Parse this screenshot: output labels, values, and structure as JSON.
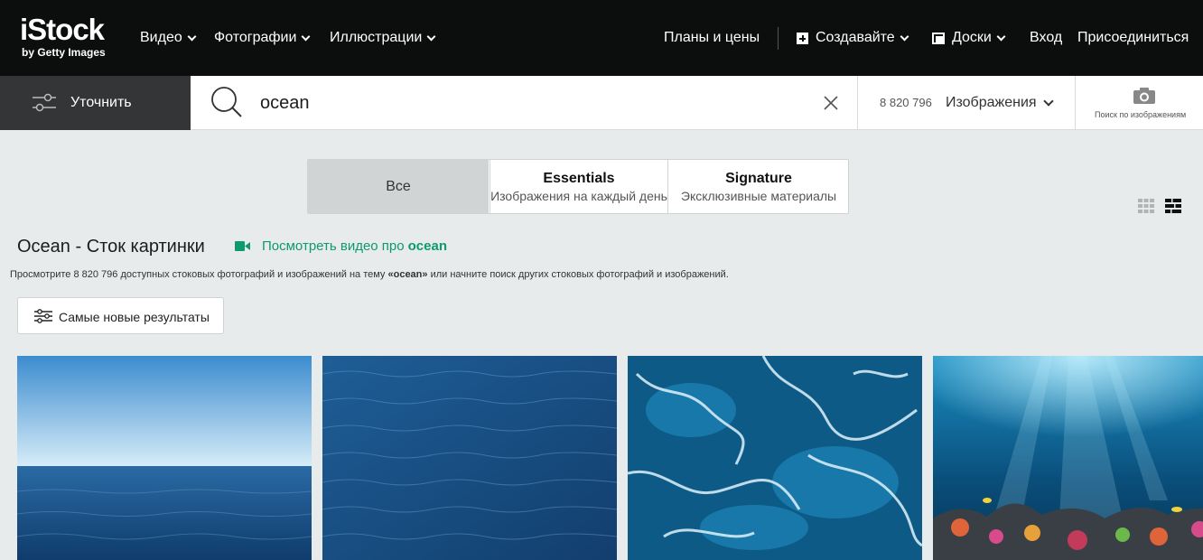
{
  "header": {
    "logo_main": "iStock",
    "logo_sub": "by Getty Images",
    "nav": [
      {
        "label": "Видео"
      },
      {
        "label": "Фотографии"
      },
      {
        "label": "Иллюстрации"
      }
    ],
    "plans_label": "Планы и цены",
    "create_label": "Создавайте",
    "boards_label": "Доски",
    "signin_label": "Вход",
    "join_label": "Присоединиться"
  },
  "search": {
    "refine_label": "Уточнить",
    "query": "ocean",
    "count": "8 820 796",
    "type_label": "Изображения",
    "image_search_label": "Поиск по изображениям"
  },
  "tabs": {
    "all": "Все",
    "essentials_title": "Essentials",
    "essentials_sub": "Изображения на каждый день",
    "signature_title": "Signature",
    "signature_sub": "Эксклюзивные материалы"
  },
  "main": {
    "title": "Ocean - Сток картинки",
    "video_link_prefix": "Посмотреть видео про",
    "video_link_term": "ocean",
    "desc_before": "Просмотрите 8 820 796 доступных стоковых фотографий и изображений на тему ",
    "desc_term": "«ocean»",
    "desc_after": " или начните поиск других стоковых фотографий и изображений.",
    "sort_label": "Самые новые результаты"
  },
  "colors": {
    "topbar_bg": "#0c0d0d",
    "refine_bg": "#333536",
    "page_bg": "#e8ebeb",
    "link_green": "#0c9a6e"
  },
  "icons": [
    "chevron-down-icon",
    "plus-square-icon",
    "boards-icon",
    "filter-sliders-icon",
    "search-icon",
    "close-icon",
    "camera-icon",
    "grid-view-icon",
    "mosaic-view-icon",
    "video-camera-icon",
    "sort-sliders-icon"
  ]
}
